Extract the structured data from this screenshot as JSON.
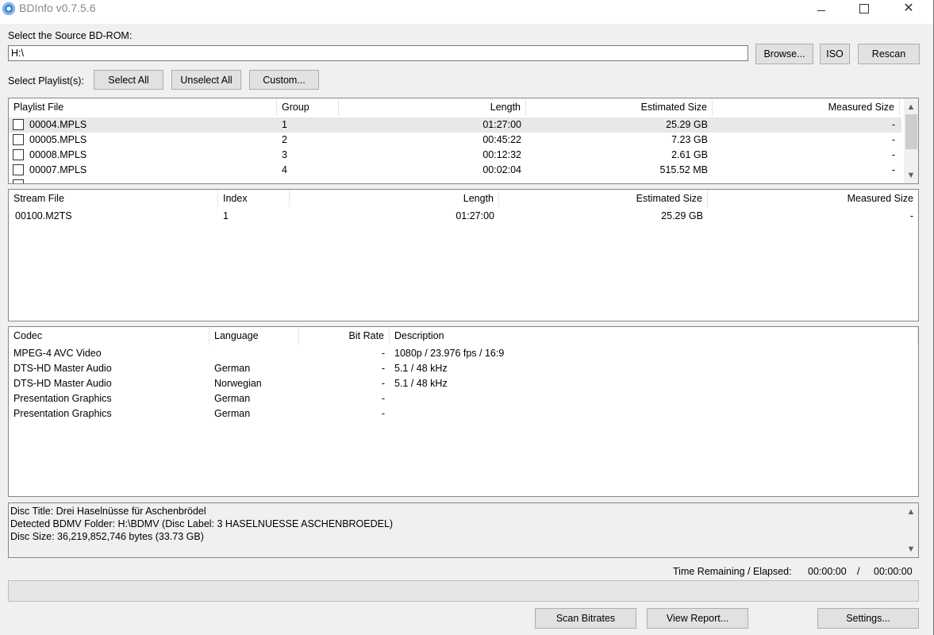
{
  "window": {
    "title": "BDInfo v0.7.5.6"
  },
  "source": {
    "label": "Select the Source BD-ROM:",
    "path": "H:\\",
    "browse_label": "Browse...",
    "iso_label": "ISO",
    "rescan_label": "Rescan"
  },
  "playlist_select": {
    "label": "Select Playlist(s):",
    "select_all": "Select All",
    "unselect_all": "Unselect All",
    "custom": "Custom..."
  },
  "playlists": {
    "columns": [
      "Playlist File",
      "Group",
      "Length",
      "Estimated Size",
      "Measured Size"
    ],
    "rows": [
      {
        "file": "00004.MPLS",
        "group": "1",
        "length": "01:27:00",
        "est": "25.29 GB",
        "meas": "-"
      },
      {
        "file": "00005.MPLS",
        "group": "2",
        "length": "00:45:22",
        "est": "7.23 GB",
        "meas": "-"
      },
      {
        "file": "00008.MPLS",
        "group": "3",
        "length": "00:12:32",
        "est": "2.61 GB",
        "meas": "-"
      },
      {
        "file": "00007.MPLS",
        "group": "4",
        "length": "00:02:04",
        "est": "515.52 MB",
        "meas": "-"
      }
    ]
  },
  "streams": {
    "columns": [
      "Stream File",
      "Index",
      "Length",
      "Estimated Size",
      "Measured Size"
    ],
    "rows": [
      {
        "file": "00100.M2TS",
        "index": "1",
        "length": "01:27:00",
        "est": "25.29 GB",
        "meas": "-"
      }
    ]
  },
  "codecs": {
    "columns": [
      "Codec",
      "Language",
      "Bit Rate",
      "Description"
    ],
    "rows": [
      {
        "codec": "MPEG-4 AVC Video",
        "lang": "",
        "bitrate": "-",
        "desc": "1080p / 23.976 fps / 16:9"
      },
      {
        "codec": "DTS-HD Master Audio",
        "lang": "German",
        "bitrate": "-",
        "desc": "5.1 / 48 kHz"
      },
      {
        "codec": "DTS-HD Master Audio",
        "lang": "Norwegian",
        "bitrate": "-",
        "desc": "5.1 / 48 kHz"
      },
      {
        "codec": "Presentation Graphics",
        "lang": "German",
        "bitrate": "-",
        "desc": ""
      },
      {
        "codec": "Presentation Graphics",
        "lang": "German",
        "bitrate": "-",
        "desc": ""
      }
    ]
  },
  "disc_info": {
    "lines": [
      "Disc Title: Drei Haselnüsse für Aschenbrödel",
      "Detected BDMV Folder: H:\\BDMV (Disc Label: 3 HASELNUESSE ASCHENBROEDEL)",
      "Disc Size: 36,219,852,746 bytes (33.73 GB)"
    ]
  },
  "status": {
    "time_label": "Time Remaining / Elapsed:",
    "remaining": "00:00:00",
    "separator": "/",
    "elapsed": "00:00:00",
    "progress": 0
  },
  "actions": {
    "scan": "Scan Bitrates",
    "report": "View Report...",
    "settings": "Settings..."
  },
  "icons": {
    "app": "bluray-disc-icon",
    "scroll_up": "▲",
    "scroll_down": "▼"
  }
}
